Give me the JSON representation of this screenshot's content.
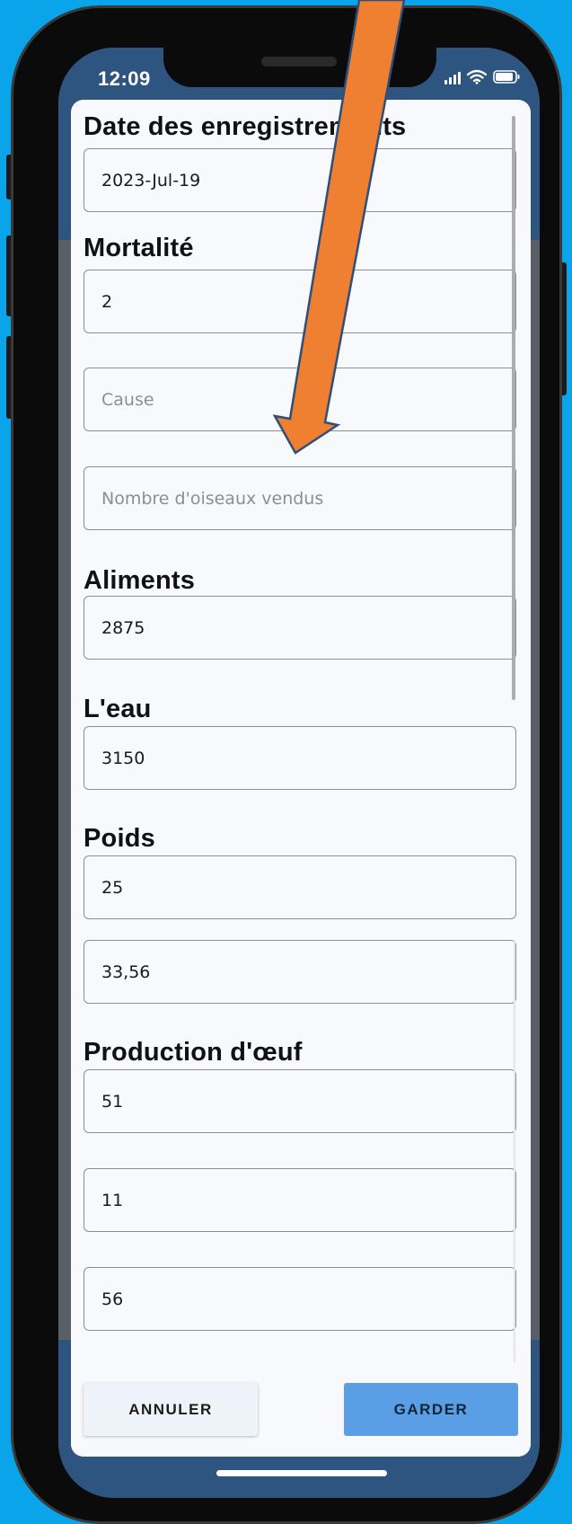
{
  "status_bar": {
    "time": "12:09"
  },
  "form": {
    "record_date_label": "Date des enregistrements",
    "record_date_value": "2023-Jul-19",
    "mortality_label": "Mortalité",
    "mortality_value": "2",
    "cause_placeholder": "Cause",
    "birds_sold_placeholder": "Nombre d'oiseaux vendus",
    "feed_label": "Aliments",
    "feed_value": "2875",
    "water_label": "L'eau",
    "water_value": "3150",
    "weight_label": "Poids",
    "weight_value_1": "25",
    "weight_value_2": "33,56",
    "egg_production_label": "Production d'œuf",
    "egg_value_1": "51",
    "egg_value_2": "11",
    "egg_value_3": "56"
  },
  "footer": {
    "cancel_label": "ANNULER",
    "save_label": "GARDER"
  },
  "colors": {
    "background": "#0aa4ea",
    "header_blue": "#2e5480",
    "save_button": "#5a9ee6",
    "annotation_arrow": "#ef7f31"
  }
}
